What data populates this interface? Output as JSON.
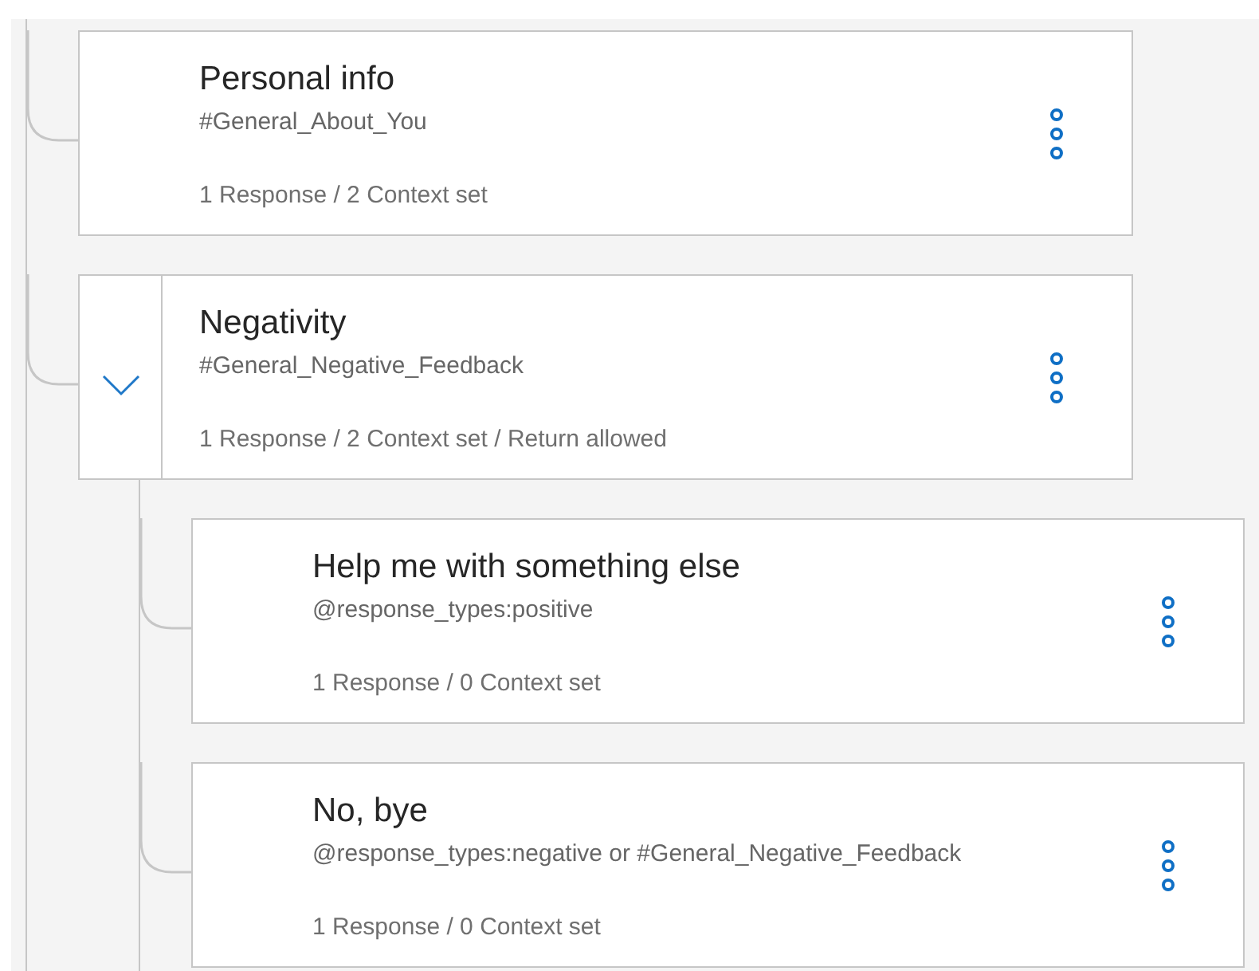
{
  "nodes": [
    {
      "title": "Personal info",
      "condition": "#General_About_You",
      "summary": "1 Response / 2 Context set"
    },
    {
      "title": "Negativity",
      "condition": "#General_Negative_Feedback",
      "summary": "1 Response / 2 Context set / Return allowed",
      "expanded": true,
      "children": [
        {
          "title": "Help me with something else",
          "condition": "@response_types:positive",
          "summary": "1 Response / 0 Context set"
        },
        {
          "title": "No, bye",
          "condition": "@response_types:negative or #General_Negative_Feedback",
          "summary": "1 Response / 0 Context set"
        }
      ]
    }
  ]
}
